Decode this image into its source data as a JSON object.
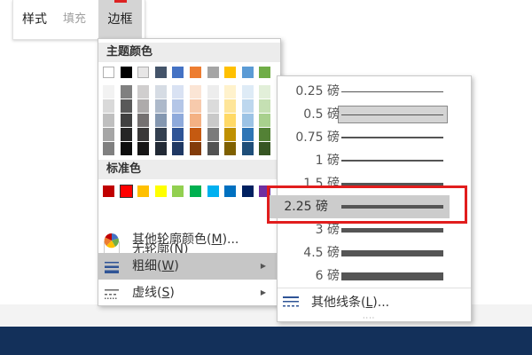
{
  "toolbar": {
    "style_label": "样式",
    "fill_label": "填充",
    "border_label": "边框"
  },
  "menu": {
    "theme_colors_label": "主题颜色",
    "theme_top": [
      "#ffffff",
      "#000000",
      "#e7e6e6",
      "#44546a",
      "#4472c4",
      "#ed7d31",
      "#a5a5a5",
      "#ffc000",
      "#5b9bd5",
      "#70ad47"
    ],
    "theme_shades": [
      [
        "#f2f2f2",
        "#d9d9d9",
        "#bfbfbf",
        "#a6a6a6",
        "#808080"
      ],
      [
        "#808080",
        "#595959",
        "#404040",
        "#262626",
        "#0d0d0d"
      ],
      [
        "#d0cece",
        "#aeabab",
        "#757171",
        "#3a3838",
        "#171616"
      ],
      [
        "#d6dce4",
        "#adb9ca",
        "#8497b0",
        "#333f4f",
        "#222a35"
      ],
      [
        "#d9e2f3",
        "#b4c6e7",
        "#8eaadb",
        "#2f5496",
        "#1f3864"
      ],
      [
        "#fbe5d5",
        "#f7caac",
        "#f4b183",
        "#c55a11",
        "#833c0b"
      ],
      [
        "#ededed",
        "#dbdbdb",
        "#c9c9c9",
        "#7b7b7b",
        "#525252"
      ],
      [
        "#fff2cc",
        "#fee599",
        "#ffd966",
        "#bf9000",
        "#7f6000"
      ],
      [
        "#deebf6",
        "#bdd7ee",
        "#9cc3e5",
        "#2e75b5",
        "#1e4e79"
      ],
      [
        "#e2efd9",
        "#c5e0b3",
        "#a8d08d",
        "#538135",
        "#375623"
      ]
    ],
    "standard_colors_label": "标准色",
    "standard": [
      "#c00000",
      "#ff0000",
      "#ffc000",
      "#ffff00",
      "#92d050",
      "#00b050",
      "#00b0f0",
      "#0070c0",
      "#002060",
      "#7030a0"
    ],
    "no_outline_label": "无轮廓(",
    "no_outline_key": "N",
    "more_colors_label": "其他轮廓颜色(",
    "more_colors_key": "M",
    "more_colors_suffix": ")...",
    "weight_label": "粗细(",
    "weight_key": "W",
    "dash_label": "虚线(",
    "dash_key": "S",
    "close_paren": ")"
  },
  "weights": [
    {
      "label": "0.25 磅"
    },
    {
      "label": "0.5 磅"
    },
    {
      "label": "0.75 磅"
    },
    {
      "label": "1 磅"
    },
    {
      "label": "1.5 磅"
    },
    {
      "label": "2.25 磅"
    },
    {
      "label": "3 磅"
    },
    {
      "label": "4.5 磅"
    },
    {
      "label": "6 磅"
    }
  ],
  "more_lines": {
    "label": "其他线条(",
    "key": "L",
    "suffix": ")..."
  },
  "colors": {
    "highlight": "#e11d1d",
    "selection": "#c6c6c6",
    "footer": "#13305a"
  }
}
